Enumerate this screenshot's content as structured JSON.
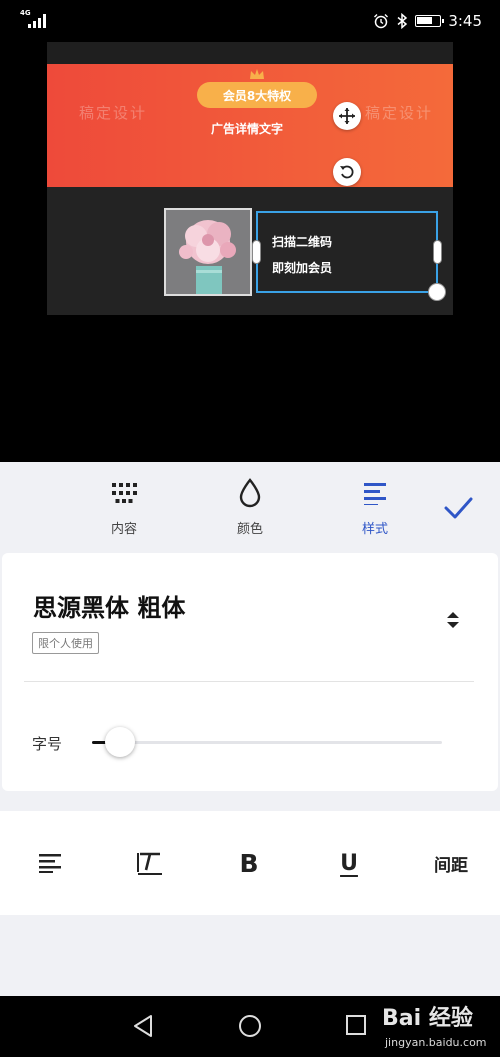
{
  "status": {
    "network": "4G",
    "time": "3:45",
    "battery_level": 0.7,
    "icons": [
      "alarm-icon",
      "bluetooth-icon",
      "battery-icon"
    ]
  },
  "canvas": {
    "badge": "会员8大特权",
    "detail": "广告详情文字",
    "watermark": "稿定设计",
    "textbox": {
      "line1": "扫描二维码",
      "line2": "即刻加会员"
    },
    "accent": "#f8b04a",
    "selection_color": "#3aa2e6"
  },
  "tabs": [
    {
      "label": "内容",
      "icon": "grid-dots-icon"
    },
    {
      "label": "颜色",
      "icon": "droplet-icon"
    },
    {
      "label": "样式",
      "icon": "align-left-icon",
      "active": true
    }
  ],
  "active_color": "#2f56c7",
  "font": {
    "name": "思源黑体 粗体",
    "tag": "限个人使用"
  },
  "size": {
    "label": "字号",
    "value": 0.08
  },
  "format": {
    "spacing": "间距",
    "bold": "B",
    "underline": "U"
  },
  "watermark_brand": {
    "logo": "Bai 经验",
    "url": "jingyan.baidu.com"
  }
}
